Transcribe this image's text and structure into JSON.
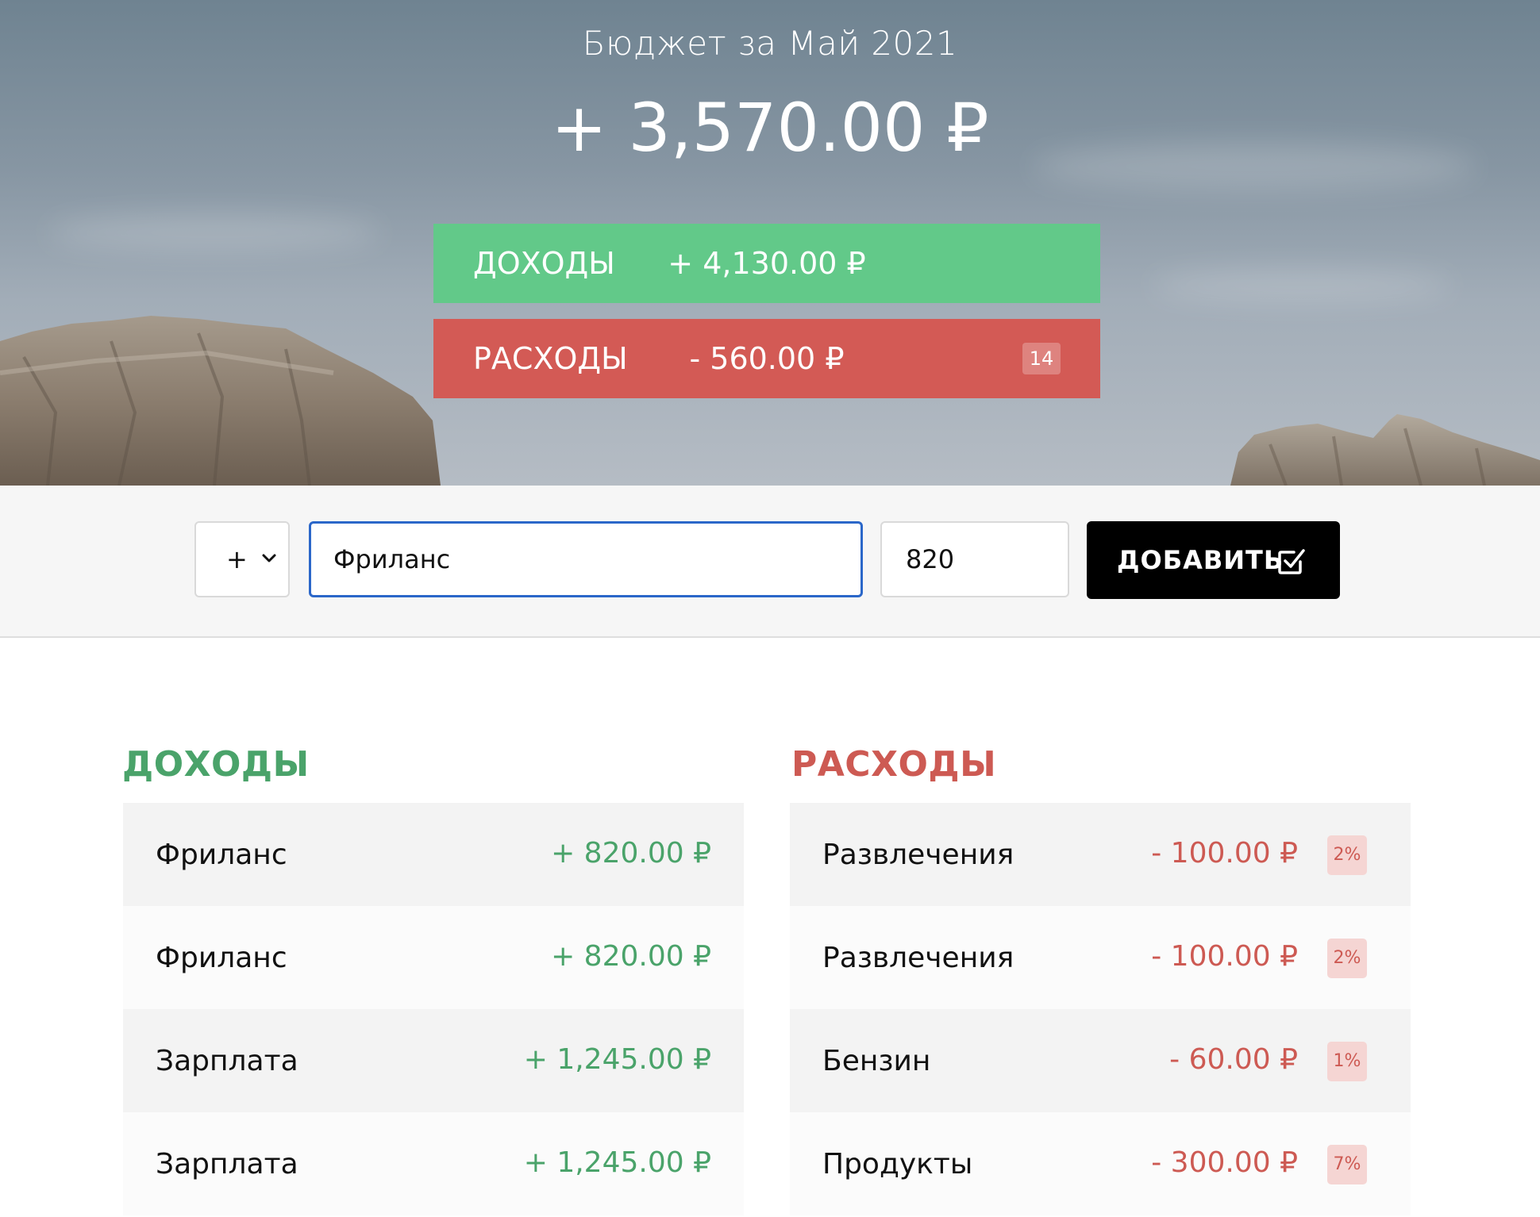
{
  "header": {
    "title": "Бюджет за Май 2021",
    "total": "+ 3,570.00 ₽",
    "income": {
      "label": "ДОХОДЫ",
      "value": "+ 4,130.00 ₽"
    },
    "expense": {
      "label": "РАСХОДЫ",
      "value": "- 560.00 ₽",
      "percent": "14"
    }
  },
  "form": {
    "type_value": "+",
    "description_value": "Фриланс",
    "amount_value": "820",
    "add_label": "ДОБАВИТЬ",
    "add_icon": "checkbox-edit-icon",
    "select_icon": "chevron-down-icon"
  },
  "income": {
    "title": "ДОХОДЫ",
    "items": [
      {
        "description": "Фриланс",
        "value": "+ 820.00 ₽"
      },
      {
        "description": "Фриланс",
        "value": "+ 820.00 ₽"
      },
      {
        "description": "Зарплата",
        "value": "+ 1,245.00 ₽"
      },
      {
        "description": "Зарплата",
        "value": "+ 1,245.00 ₽"
      }
    ]
  },
  "expenses": {
    "title": "РАСХОДЫ",
    "items": [
      {
        "description": "Развлечения",
        "value": "- 100.00 ₽",
        "percent": "2%"
      },
      {
        "description": "Развлечения",
        "value": "- 100.00 ₽",
        "percent": "2%"
      },
      {
        "description": "Бензин",
        "value": "- 60.00 ₽",
        "percent": "1%"
      },
      {
        "description": "Продукты",
        "value": "- 300.00 ₽",
        "percent": "7%"
      }
    ]
  },
  "colors": {
    "income_bar": "#62c989",
    "expense_bar": "#d35a55",
    "income_text": "#4aa36a",
    "expense_text": "#cd5a53",
    "focus_border": "#2b67c9",
    "button_bg": "#000000"
  }
}
